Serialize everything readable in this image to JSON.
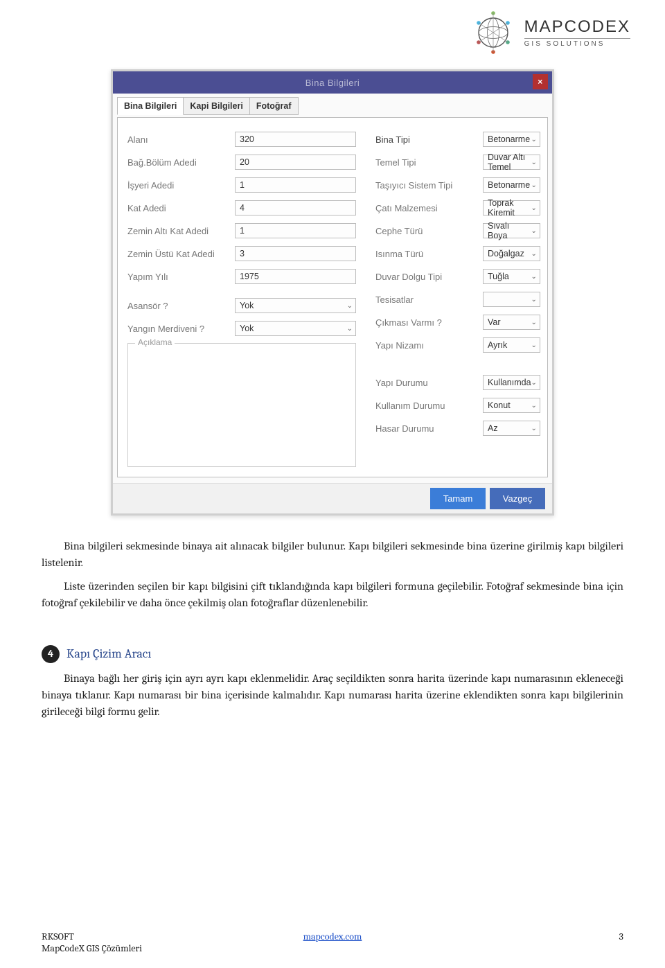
{
  "logo": {
    "brand": "MAPCODEX",
    "sub": "GIS  SOLUTIONS"
  },
  "dialog": {
    "title": "Bina Bilgileri",
    "close_icon_char": "×",
    "tabs": {
      "bina": "Bina Bilgileri",
      "kapi": "Kapi Bilgileri",
      "foto": "Fotoğraf"
    },
    "left_inputs": {
      "alani_lbl": "Alanı",
      "alani_val": "320",
      "bagbolum_lbl": "Bağ.Bölüm Adedi",
      "bagbolum_val": "20",
      "isyeri_lbl": "İşyeri Adedi",
      "isyeri_val": "1",
      "kat_lbl": "Kat Adedi",
      "kat_val": "4",
      "zeminalti_lbl": "Zemin Altı Kat Adedi",
      "zeminalti_val": "1",
      "zeminustu_lbl": "Zemin Üstü Kat Adedi",
      "zeminustu_val": "3",
      "yapim_lbl": "Yapım Yılı",
      "yapim_val": "1975",
      "asansor_lbl": "Asansör ?",
      "asansor_val": "Yok",
      "yangin_lbl": "Yangın Merdiveni ?",
      "yangin_val": "Yok",
      "aciklama_lbl": "Açıklama",
      "aciklama_val": ""
    },
    "right_selects": {
      "bina_tipi_lbl": "Bina Tipi",
      "bina_tipi_val": "Betonarme",
      "temel_tipi_lbl": "Temel Tipi",
      "temel_tipi_val": "Duvar Altı Temel",
      "tasiyici_lbl": "Taşıyıcı Sistem Tipi",
      "tasiyici_val": "Betonarme",
      "cati_lbl": "Çatı Malzemesi",
      "cati_val": "Toprak Kiremit",
      "cephe_lbl": "Cephe Türü",
      "cephe_val": "Sıvalı Boya",
      "isinma_lbl": "Isınma Türü",
      "isinma_val": "Doğalgaz",
      "dolgu_lbl": "Duvar Dolgu Tipi",
      "dolgu_val": "Tuğla",
      "tesisat_lbl": "Tesisatlar",
      "tesisat_val": "",
      "cikmasi_lbl": "Çıkması Varmı ?",
      "cikmasi_val": "Var",
      "nizam_lbl": "Yapı Nizamı",
      "nizam_val": "Ayrık",
      "yapi_durumu_lbl": "Yapı Durumu",
      "yapi_durumu_val": "Kullanımda",
      "kullanim_lbl": "Kullanım Durumu",
      "kullanim_val": "Konut",
      "hasar_lbl": "Hasar Durumu",
      "hasar_val": "Az"
    },
    "buttons": {
      "ok": "Tamam",
      "cancel": "Vazgeç"
    }
  },
  "doc": {
    "p1": "Bina bilgileri sekmesinde binaya ait alınacak bilgiler bulunur. Kapı bilgileri sekmesinde bina üzerine girilmiş kapı bilgileri listelenir.",
    "p2": "Liste üzerinden seçilen bir kapı bilgisini çift tıklandığında kapı bilgileri formuna geçilebilir. Fotoğraf sekmesinde bina için fotoğraf çekilebilir ve daha önce çekilmiş olan fotoğraflar düzenlenebilir.",
    "sec_num": "4",
    "sec_title": "Kapı Çizim Aracı",
    "p3": "Binaya bağlı her giriş için ayrı ayrı kapı eklenmelidir. Araç seçildikten sonra harita üzerinde kapı numarasının ekleneceği binaya tıklanır. Kapı numarası bir bina içerisinde kalmalıdır. Kapı numarası harita üzerine eklendikten sonra kapı bilgilerinin girileceği bilgi formu gelir."
  },
  "footer": {
    "line1": "RKSOFT",
    "line2": "MapCodeX GIS Çözümleri",
    "center": "mapcodex.com",
    "page": "3"
  }
}
